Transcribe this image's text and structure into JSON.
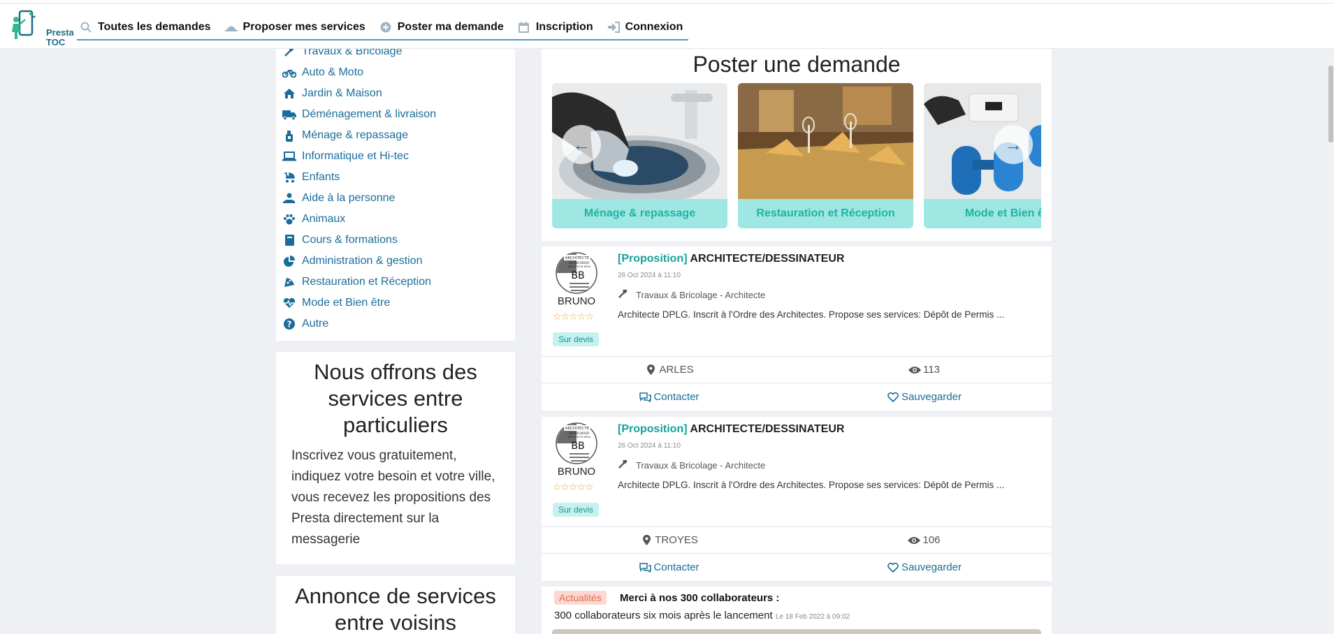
{
  "header": {
    "logo_line1": "Presta",
    "logo_line2": "TOC",
    "nav": [
      {
        "label": "Toutes les demandes",
        "icon": "search-icon"
      },
      {
        "label": "Proposer mes services",
        "icon": "bell-icon"
      },
      {
        "label": "Poster ma demande",
        "icon": "plus-circle-icon"
      },
      {
        "label": "Inscription",
        "icon": "calendar-icon"
      },
      {
        "label": "Connexion",
        "icon": "sign-in-icon"
      }
    ]
  },
  "categories": [
    {
      "label": "Travaux & Bricolage",
      "icon": "hammer-icon"
    },
    {
      "label": "Auto & Moto",
      "icon": "motorcycle-icon"
    },
    {
      "label": "Jardin & Maison",
      "icon": "home-icon"
    },
    {
      "label": "Déménagement & livraison",
      "icon": "truck-icon"
    },
    {
      "label": "Ménage & repassage",
      "icon": "spray-bottle-icon"
    },
    {
      "label": "Informatique et Hi-tec",
      "icon": "laptop-icon"
    },
    {
      "label": "Enfants",
      "icon": "baby-carriage-icon"
    },
    {
      "label": "Aide à la personne",
      "icon": "hand-holding-icon"
    },
    {
      "label": "Animaux",
      "icon": "paw-icon"
    },
    {
      "label": "Cours & formations",
      "icon": "book-icon"
    },
    {
      "label": "Administration & gestion",
      "icon": "pie-chart-icon"
    },
    {
      "label": "Restauration et Réception",
      "icon": "pizza-icon"
    },
    {
      "label": "Mode et Bien être",
      "icon": "heartbeat-icon"
    },
    {
      "label": "Autre",
      "icon": "question-circle-icon"
    }
  ],
  "info": {
    "title": "Nous offrons des services entre particuliers",
    "text": "Inscrivez vous gratuitement, indiquez votre besoin et votre ville, vous recevez les propositions des Presta directement sur la messagerie"
  },
  "annonce": {
    "title": "Annonce de services entre voisins"
  },
  "post": {
    "title": "Poster une demande",
    "slides": [
      "Ménage & repassage",
      "Restauration et Réception",
      "Mode et Bien être"
    ]
  },
  "listings": [
    {
      "avatar_top": "ARCHITECTE",
      "avatar_name_small": "BRUNO BOSSY",
      "avatar_sub": "ARCHITECTE DPLG",
      "avatar_initials": "BB",
      "user": "BRUNO",
      "stars": "☆☆☆☆☆",
      "rating": 0,
      "price": "Sur devis",
      "tag": "[Proposition]",
      "title": "ARCHITECTE/DESSINATEUR",
      "date": "26 Oct 2024 à 11:10",
      "category": "Travaux & Bricolage - Architecte",
      "desc": "Architecte DPLG. Inscrit à l'Ordre des Architectes. Propose ses services: Dépôt de Permis ...",
      "city": "ARLES",
      "views": "113",
      "contact": "Contacter",
      "save": "Sauvegarder"
    },
    {
      "avatar_top": "ARCHITECTE",
      "avatar_name_small": "BRUNO BOSSY",
      "avatar_sub": "ARCHITECTE DPLG",
      "avatar_initials": "BB",
      "user": "BRUNO",
      "stars": "☆☆☆☆☆",
      "rating": 0,
      "price": "Sur devis",
      "tag": "[Proposition]",
      "title": "ARCHITECTE/DESSINATEUR",
      "date": "26 Oct 2024 à 11:10",
      "category": "Travaux & Bricolage - Architecte",
      "desc": "Architecte DPLG. Inscrit à l'Ordre des Architectes. Propose ses services: Dépôt de Permis ...",
      "city": "TROYES",
      "views": "106",
      "contact": "Contacter",
      "save": "Sauvegarder"
    }
  ],
  "news": {
    "badge": "Actualités",
    "title": "Merci à nos 300 collaborateurs :",
    "line": "300 collaborateurs six mois après le lancement",
    "date": "Le 18 Feb 2022 à 09:02"
  },
  "colors": {
    "link": "#1a6d9a",
    "accent_teal": "#14a39a",
    "caption_bg": "#9ee7e3",
    "background": "#eef0f3"
  }
}
